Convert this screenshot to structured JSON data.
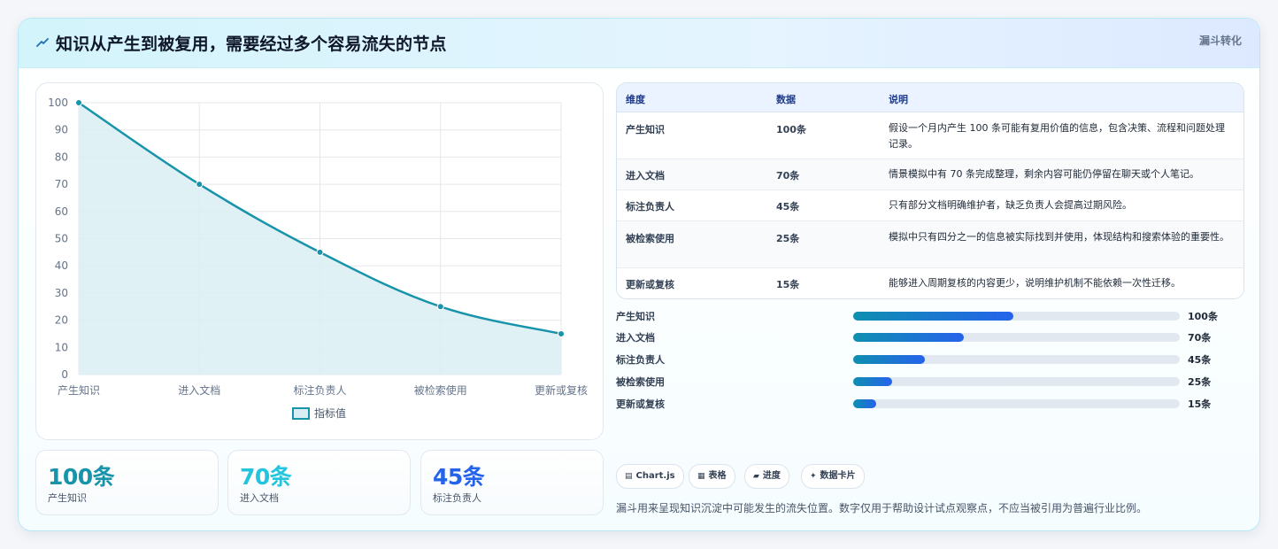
{
  "header": {
    "title": "知识从产生到被复用，需要经过多个容易流失的节点",
    "badge": "漏斗转化"
  },
  "chart_data": {
    "type": "line",
    "categories": [
      "产生知识",
      "进入文档",
      "标注负责人",
      "被检索使用",
      "更新或复核"
    ],
    "series": [
      {
        "name": "指标值",
        "values": [
          100,
          70,
          45,
          25,
          15
        ]
      }
    ],
    "ylim": [
      0,
      100
    ],
    "yticks": [
      0,
      10,
      20,
      30,
      40,
      50,
      60,
      70,
      80,
      90,
      100
    ],
    "grid": true,
    "fill": true,
    "legend_position": "bottom",
    "colors": {
      "line": "#1793aa",
      "fill": "#d9eef3"
    }
  },
  "stats": [
    {
      "value": "100条",
      "label": "产生知识",
      "color": "#1793aa"
    },
    {
      "value": "70条",
      "label": "进入文档",
      "color": "#22c5dd"
    },
    {
      "value": "45条",
      "label": "标注负责人",
      "color": "#2563eb"
    }
  ],
  "table": {
    "headers": [
      "维度",
      "数据",
      "说明"
    ],
    "rows": [
      {
        "dim": "产生知识",
        "data": "100条",
        "desc": "假设一个月内产生 100 条可能有复用价值的信息，包含决策、流程和问题处理记录。"
      },
      {
        "dim": "进入文档",
        "data": "70条",
        "desc": "情景模拟中有 70 条完成整理，剩余内容可能仍停留在聊天或个人笔记。"
      },
      {
        "dim": "标注负责人",
        "data": "45条",
        "desc": "只有部分文档明确维护者，缺乏负责人会提高过期风险。"
      },
      {
        "dim": "被检索使用",
        "data": "25条",
        "desc": "模拟中只有四分之一的信息被实际找到并使用，体现结构和搜索体验的重要性。"
      },
      {
        "dim": "更新或复核",
        "data": "15条",
        "desc": "能够进入周期复核的内容更少，说明维护机制不能依赖一次性迁移。"
      }
    ]
  },
  "progress": [
    {
      "label": "产生知识",
      "value": "100条",
      "fraction": 0.49
    },
    {
      "label": "进入文档",
      "value": "70条",
      "fraction": 0.34
    },
    {
      "label": "标注负责人",
      "value": "45条",
      "fraction": 0.22
    },
    {
      "label": "被检索使用",
      "value": "25条",
      "fraction": 0.12
    },
    {
      "label": "更新或复核",
      "value": "15条",
      "fraction": 0.07
    }
  ],
  "chips": [
    {
      "icon": "▤",
      "label": "Chart.js"
    },
    {
      "icon": "▦",
      "label": "表格"
    },
    {
      "icon": "▰",
      "label": "进度"
    },
    {
      "icon": "✦",
      "label": "数据卡片"
    }
  ],
  "note": "漏斗用来呈现知识沉淀中可能发生的流失位置。数字仅用于帮助设计试点观察点，不应当被引用为普遍行业比例。"
}
